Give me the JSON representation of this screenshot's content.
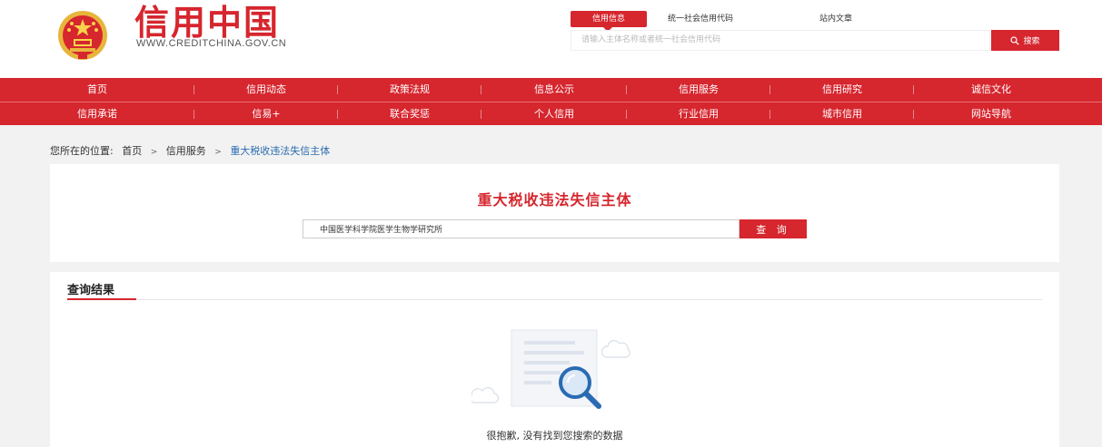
{
  "header": {
    "logo_title": "信用中国",
    "logo_url": "WWW.CREDITCHINA.GOV.CN",
    "search_tabs": [
      "信用信息",
      "统一社会信用代码",
      "站内文章"
    ],
    "search_placeholder": "请输入主体名称或者统一社会信用代码",
    "search_button": "搜索"
  },
  "nav": {
    "row1": [
      "首页",
      "信用动态",
      "政策法规",
      "信息公示",
      "信用服务",
      "信用研究",
      "诚信文化"
    ],
    "row2": [
      "信用承诺",
      "信易+",
      "联合奖惩",
      "个人信用",
      "行业信用",
      "城市信用",
      "网站导航"
    ]
  },
  "breadcrumb": {
    "prefix": "您所在的位置:",
    "items": [
      "首页",
      "信用服务"
    ],
    "current": "重大税收违法失信主体",
    "separator": ">"
  },
  "query": {
    "title": "重大税收违法失信主体",
    "input_value": "中国医学科学院医学生物学研究所",
    "button": "查 询"
  },
  "results": {
    "title": "查询结果",
    "empty_message": "很抱歉, 没有找到您搜索的数据"
  },
  "colors": {
    "brand_red": "#d6262e",
    "breadcrumb_link": "#2b6cb0",
    "page_bg": "#f2f2f2"
  }
}
